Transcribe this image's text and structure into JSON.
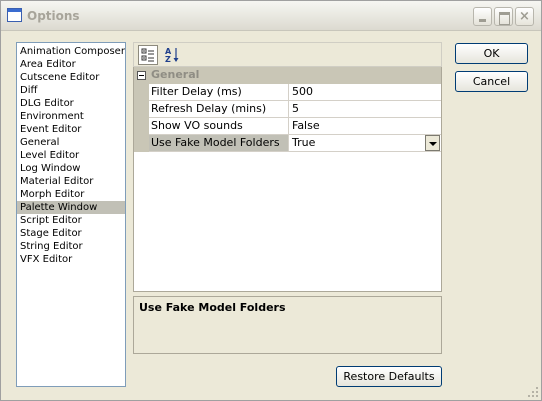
{
  "window": {
    "title": "Options",
    "controls": {
      "minimize": "minimize",
      "maximize": "maximize",
      "close": "×"
    }
  },
  "sidebar": {
    "items": [
      {
        "label": "Animation Composer"
      },
      {
        "label": "Area Editor"
      },
      {
        "label": "Cutscene Editor"
      },
      {
        "label": "Diff"
      },
      {
        "label": "DLG Editor"
      },
      {
        "label": "Environment"
      },
      {
        "label": "Event Editor"
      },
      {
        "label": "General"
      },
      {
        "label": "Level Editor"
      },
      {
        "label": "Log Window"
      },
      {
        "label": "Material Editor"
      },
      {
        "label": "Morph Editor"
      },
      {
        "label": "Palette Window",
        "selected": true
      },
      {
        "label": "Script Editor"
      },
      {
        "label": "Stage Editor"
      },
      {
        "label": "String Editor"
      },
      {
        "label": "VFX Editor"
      }
    ]
  },
  "toolbar": {
    "categorized_icon": "categorized-icon",
    "alphabetical_icon": "alphabetical-icon",
    "alphabetical_glyph": "A↓Z"
  },
  "grid": {
    "category": "General",
    "properties": [
      {
        "name": "Filter Delay (ms)",
        "value": "500"
      },
      {
        "name": "Refresh Delay (mins)",
        "value": "5"
      },
      {
        "name": "Show VO sounds",
        "value": "False"
      },
      {
        "name": "Use Fake Model Folders",
        "value": "True",
        "selected": true,
        "has_dropdown": true
      }
    ]
  },
  "description": {
    "title": "Use Fake Model Folders",
    "body": ""
  },
  "buttons": {
    "ok": "OK",
    "cancel": "Cancel",
    "restore": "Restore Defaults"
  },
  "colors": {
    "window_bg": "#ece9d8",
    "selection": "#c1c0b6",
    "button_border": "#003c74"
  }
}
